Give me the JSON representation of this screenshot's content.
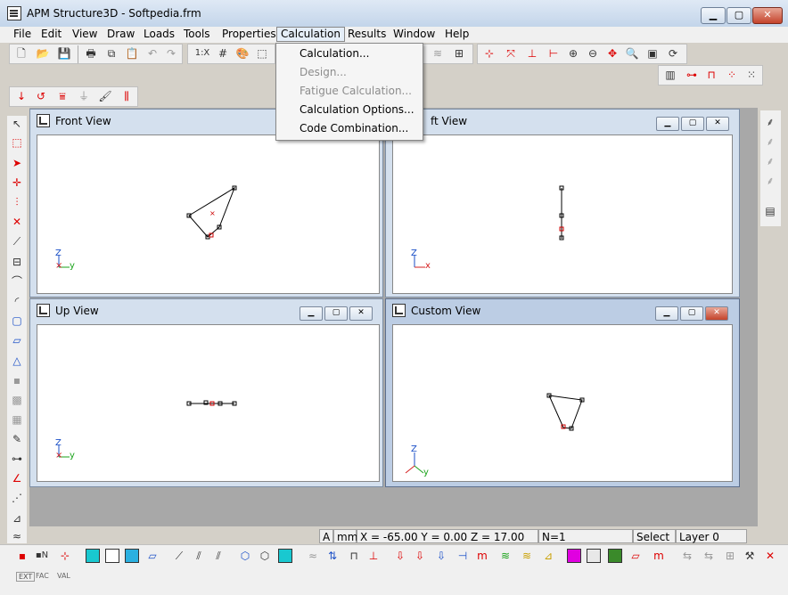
{
  "window": {
    "title": "APM Structure3D - Softpedia.frm"
  },
  "menu": {
    "items": [
      "File",
      "Edit",
      "View",
      "Draw",
      "Loads",
      "Tools",
      "Properties",
      "Calculation",
      "Results",
      "Window",
      "Help"
    ],
    "active": "Calculation"
  },
  "calculation_menu": {
    "items": [
      {
        "label": "Calculation...",
        "enabled": true
      },
      {
        "label": "Design...",
        "enabled": false
      },
      {
        "label": "Fatigue Calculation...",
        "enabled": false
      },
      {
        "label": "Calculation Options...",
        "enabled": true
      },
      {
        "label": "Code Combination...",
        "enabled": true
      }
    ]
  },
  "toolbar": {
    "scale_label": "1:X"
  },
  "views": {
    "front": {
      "title": "Front View",
      "axes": {
        "up": "Z",
        "right": "y"
      }
    },
    "left": {
      "title": "Left View",
      "title_visible": "ft View",
      "axes": {
        "up": "Z",
        "right": "x"
      }
    },
    "up": {
      "title": "Up View",
      "axes": {
        "up": "Z",
        "right": "y"
      }
    },
    "custom": {
      "title": "Custom View",
      "axes": {
        "up": "Z",
        "right": "y"
      }
    }
  },
  "status": {
    "mode_letter": "A",
    "units": "mm",
    "coords": "X = -65.00 Y = 0.00 Z = 17.00",
    "n_count": "N=1",
    "tool": "Select",
    "layer": "Layer 0"
  },
  "bottom_tabs": {
    "ext": "EXT",
    "fac": "FAC",
    "val": "VAL"
  },
  "colors": {
    "accent": "#1a4fc7",
    "close_red": "#c4432b",
    "axis_z": "#1a4fc7",
    "axis_y": "#1aa31a",
    "axis_x": "#d42020"
  }
}
